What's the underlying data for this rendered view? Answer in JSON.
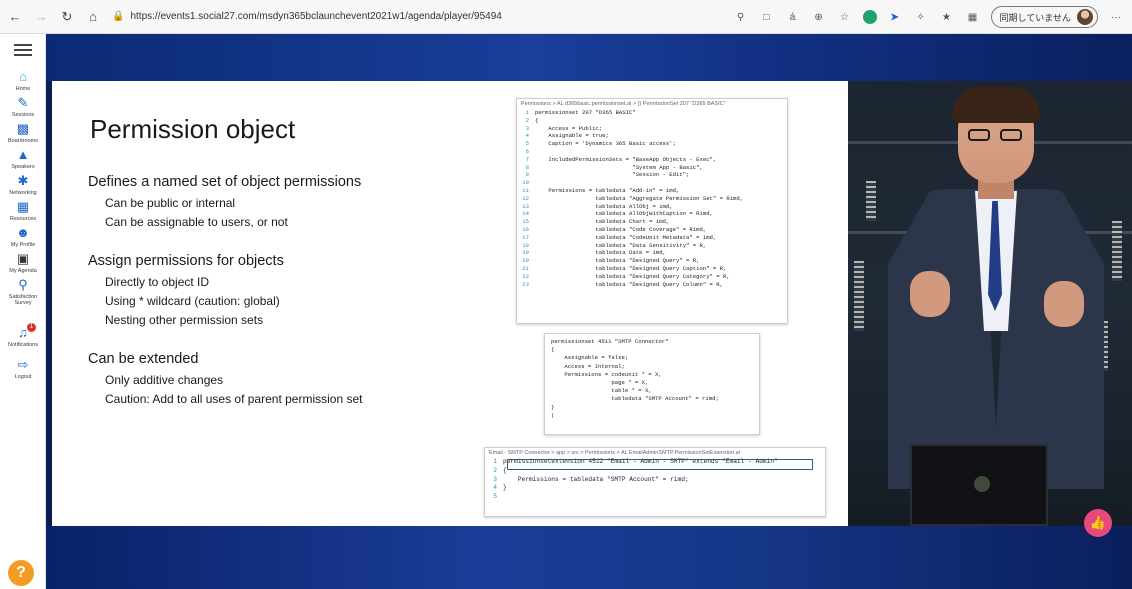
{
  "browser": {
    "url": "https://events1.social27.com/msdyn365bclaunchevent2021w1/agenda/player/95494",
    "profile_label": "同期していません",
    "more_label": "···"
  },
  "sidebar": {
    "items": [
      {
        "label": "Home",
        "icon": "home-icon"
      },
      {
        "label": "Sessions",
        "icon": "pen-icon"
      },
      {
        "label": "Boardrooms",
        "icon": "boardroom-icon"
      },
      {
        "label": "Speakers",
        "icon": "speaker-icon"
      },
      {
        "label": "Networking",
        "icon": "network-icon"
      },
      {
        "label": "Resources",
        "icon": "resources-icon"
      },
      {
        "label": "My Profile",
        "icon": "profile-icon"
      },
      {
        "label": "My Agenda",
        "icon": "calendar-icon"
      },
      {
        "label": "Satisfaction Survey",
        "icon": "survey-icon"
      },
      {
        "label": "Notifications",
        "icon": "bell-icon",
        "badge": "1"
      },
      {
        "label": "Logout",
        "icon": "logout-icon"
      }
    ],
    "help_label": "?"
  },
  "slide": {
    "title": "Permission object",
    "groups": [
      {
        "heading": "Defines a named set of object permissions",
        "items": [
          "Can be public or internal",
          "Can be assignable to users, or not"
        ]
      },
      {
        "heading": "Assign permissions for objects",
        "items": [
          "Directly to object ID",
          "Using * wildcard (caution: global)",
          "Nesting other permission sets"
        ]
      },
      {
        "heading": "Can be extended",
        "items": [
          "Only additive changes",
          "Caution: Add to all uses of parent permission set"
        ]
      }
    ]
  },
  "code1": {
    "crumb": "Permissions > AL d365basic.permissionset.al > {} PermissionSet 207 \"D365 BASIC\"",
    "lines": [
      {
        "n": "1",
        "t": "permissionset 207 \"D365 BASIC\""
      },
      {
        "n": "2",
        "t": "{"
      },
      {
        "n": "3",
        "t": "    Access = Public;"
      },
      {
        "n": "4",
        "t": "    Assignable = true;"
      },
      {
        "n": "5",
        "t": "    Caption = 'Dynamics 365 Basic access';"
      },
      {
        "n": "6",
        "t": ""
      },
      {
        "n": "7",
        "t": "    IncludedPermissionSets = \"BaseApp Objects - Exec\","
      },
      {
        "n": "8",
        "t": "                             \"System App - Basic\","
      },
      {
        "n": "9",
        "t": "                             \"Session - Edit\";"
      },
      {
        "n": "10",
        "t": ""
      },
      {
        "n": "11",
        "t": "    Permissions = tabledata \"Add-in\" = imd,"
      },
      {
        "n": "12",
        "t": "                  tabledata \"Aggregate Permission Set\" = Rimd,"
      },
      {
        "n": "13",
        "t": "                  tabledata AllObj = imd,"
      },
      {
        "n": "14",
        "t": "                  tabledata AllObjWithCaption = Rimd,"
      },
      {
        "n": "15",
        "t": "                  tabledata Chart = imd,"
      },
      {
        "n": "16",
        "t": "                  tabledata \"Code Coverage\" = Rimd,"
      },
      {
        "n": "17",
        "t": "                  tabledata \"CodeUnit Metadata\" = imd,"
      },
      {
        "n": "18",
        "t": "                  tabledata \"Data Sensitivity\" = R,"
      },
      {
        "n": "19",
        "t": "                  tabledata Date = imd,"
      },
      {
        "n": "20",
        "t": "                  tabledata \"Designed Query\" = R,"
      },
      {
        "n": "21",
        "t": "                  tabledata \"Designed Query Caption\" = R,"
      },
      {
        "n": "22",
        "t": "                  tabledata \"Designed Query Category\" = R,"
      },
      {
        "n": "23",
        "t": "                  tabledata \"Designed Query Column\" = R,"
      }
    ]
  },
  "code2": {
    "lines": [
      "permissionset 4511 \"SMTP Connector\"",
      "{",
      "    Assignable = false;",
      "    Access = Internal;",
      "    Permissions = codeunit * = X,",
      "                  page * = X,",
      "                  table * = X,",
      "                  tabledata \"SMTP Account\" = rimd;",
      "}",
      "|"
    ]
  },
  "code3": {
    "crumb": "Email - SMTP Connector > app > src > Permissions > AL EmailAdminSMTP.PermissionSetExtension.al",
    "lines": [
      {
        "n": "1",
        "t": "permissionsetextension 4512 \"Email - Admin - SMTP\" extends \"Email - Admin\""
      },
      {
        "n": "2",
        "t": "{"
      },
      {
        "n": "3",
        "t": "    Permissions = tabledata \"SMTP Account\" = rimd;"
      },
      {
        "n": "4",
        "t": "}"
      },
      {
        "n": "5",
        "t": ""
      }
    ]
  },
  "player": {
    "like_icon": "thumbs-up-icon",
    "accent": "#e8487d"
  }
}
